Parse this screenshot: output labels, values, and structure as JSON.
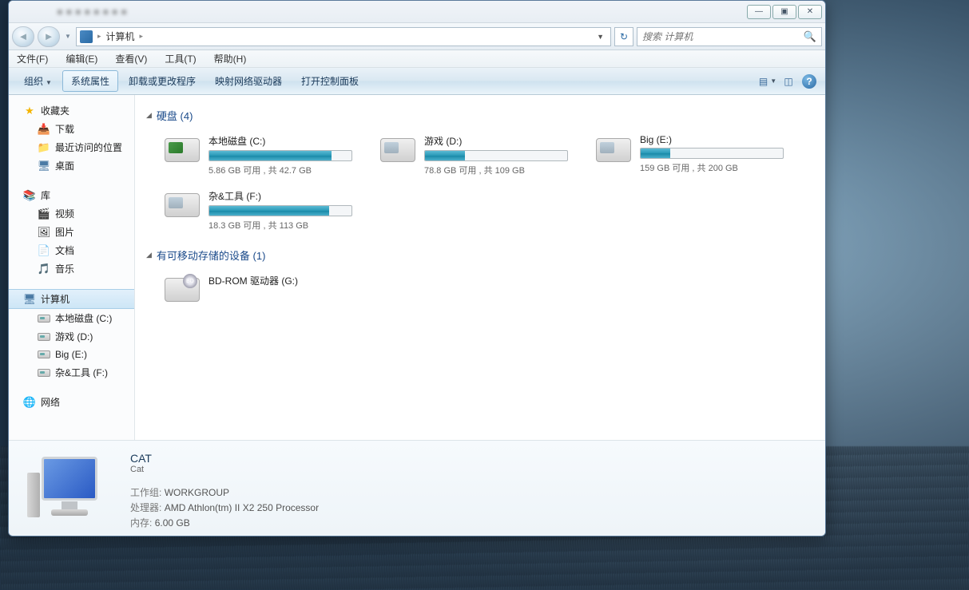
{
  "window_controls": {
    "minimize": "—",
    "maximize": "▣",
    "close": "✕"
  },
  "nav": {
    "back": "◄",
    "forward": "►"
  },
  "address": {
    "location": "计算机",
    "sep": "▸"
  },
  "search": {
    "placeholder": "搜索 计算机"
  },
  "menu": {
    "file": "文件(F)",
    "edit": "编辑(E)",
    "view": "查看(V)",
    "tools": "工具(T)",
    "help": "帮助(H)"
  },
  "toolbar": {
    "organize": "组织",
    "properties": "系统属性",
    "uninstall": "卸载或更改程序",
    "map_drive": "映射网络驱动器",
    "control_panel": "打开控制面板"
  },
  "sidebar": {
    "favorites": "收藏夹",
    "downloads": "下载",
    "recent": "最近访问的位置",
    "desktop": "桌面",
    "libraries": "库",
    "videos": "视频",
    "pictures": "图片",
    "documents": "文档",
    "music": "音乐",
    "computer": "计算机",
    "drive_c": "本地磁盘 (C:)",
    "drive_d": "游戏 (D:)",
    "drive_e": "Big (E:)",
    "drive_f": "杂&工具 (F:)",
    "network": "网络"
  },
  "content": {
    "hdd_header": "硬盘 (4)",
    "removable_header": "有可移动存储的设备 (1)",
    "drives": [
      {
        "name": "本地磁盘 (C:)",
        "stat": "5.86 GB 可用 , 共 42.7 GB",
        "fill": 86
      },
      {
        "name": "游戏 (D:)",
        "stat": "78.8 GB 可用 , 共 109 GB",
        "fill": 28
      },
      {
        "name": "Big (E:)",
        "stat": "159 GB 可用 , 共 200 GB",
        "fill": 21
      },
      {
        "name": "杂&工具 (F:)",
        "stat": "18.3 GB 可用 , 共 113 GB",
        "fill": 84
      }
    ],
    "optical": {
      "name": "BD-ROM 驱动器 (G:)"
    }
  },
  "details": {
    "title": "CAT",
    "subtitle": "Cat",
    "workgroup_label": "工作组:",
    "workgroup": "WORKGROUP",
    "cpu_label": "处理器:",
    "cpu": "AMD Athlon(tm) II X2 250 Processor",
    "ram_label": "内存:",
    "ram": "6.00 GB"
  }
}
